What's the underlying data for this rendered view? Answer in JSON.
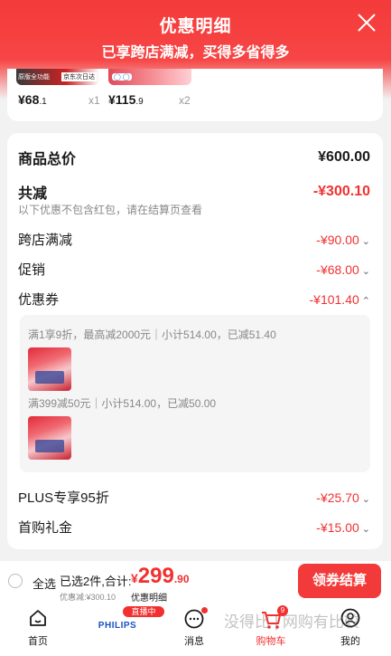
{
  "header": {
    "title": "优惠明细",
    "subtitle": "已享跨店满减，买得多省得多"
  },
  "top_items": [
    {
      "price_int": "¥68",
      "price_dec": ".1",
      "qty": "x1",
      "label_a": "原版全功能",
      "label_b": "京东次日达"
    },
    {
      "price_int": "¥115",
      "price_dec": ".9",
      "qty": "x2"
    }
  ],
  "summary": {
    "goods_total_label": "商品总价",
    "goods_total_value": "¥600.00",
    "total_reduction_label": "共减",
    "total_reduction_value": "-¥300.10",
    "note": "以下优惠不包含红包，请在结算页查看",
    "lines": [
      {
        "label": "跨店满减",
        "value": "-¥90.00",
        "chevron": "down"
      },
      {
        "label": "促销",
        "value": "-¥68.00",
        "chevron": "down"
      },
      {
        "label": "优惠券",
        "value": "-¥101.40",
        "chevron": "up"
      }
    ],
    "coupons": [
      {
        "text": "满1享9折，最高减2000元｜小计514.00，已减51.40"
      },
      {
        "text": "满399减50元｜小计514.00，已减50.00"
      }
    ],
    "extra_lines": [
      {
        "label": "PLUS专享95折",
        "value": "-¥25.70",
        "chevron": "down"
      },
      {
        "label": "首购礼金",
        "value": "-¥15.00",
        "chevron": "down"
      }
    ]
  },
  "bottom_bar": {
    "select_all": "全选",
    "selected_text": "已选2件,合计:",
    "total_cur": "¥",
    "total_int": "299",
    "total_dec": ".90",
    "discount_note": "优惠减:¥300.10",
    "detail_link": "优惠明细",
    "checkout_label": "领券结算"
  },
  "nav": {
    "items": [
      {
        "label": "首页",
        "icon": "home-icon"
      },
      {
        "label": "",
        "icon": "philips-live-icon"
      },
      {
        "label": "消息",
        "icon": "message-icon"
      },
      {
        "label": "购物车",
        "icon": "cart-icon",
        "badge": "9"
      },
      {
        "label": "我的",
        "icon": "user-icon"
      }
    ],
    "live_tag": "直播中",
    "brand": "PHILIPS"
  },
  "watermark": "没得比 | 网购有比较",
  "colors": {
    "accent": "#f23030",
    "header_red": "#f43a3a",
    "checkout_bg": "#f33a3a"
  }
}
